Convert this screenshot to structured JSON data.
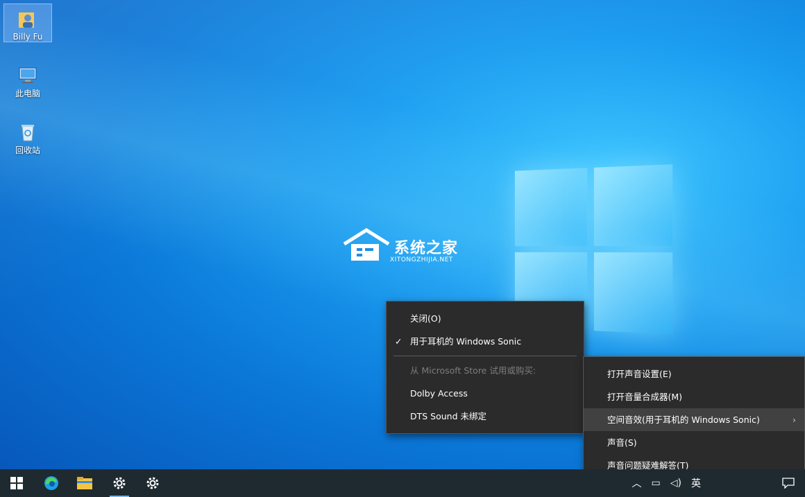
{
  "desktop": {
    "icons": [
      {
        "label": "Billy Fu",
        "icon": "user-folder-icon"
      },
      {
        "label": "此电脑",
        "icon": "computer-icon"
      },
      {
        "label": "回收站",
        "icon": "recycle-bin-icon"
      }
    ],
    "watermark": {
      "title": "系统之家",
      "subtitle": "XITONGZHIJIA.NET"
    }
  },
  "submenu": {
    "items": [
      {
        "label": "关闭(O)",
        "checked": false,
        "disabled": false
      },
      {
        "label": "用于耳机的 Windows Sonic",
        "checked": true,
        "disabled": false
      },
      {
        "label": "从 Microsoft Store 试用或购买:",
        "disabled": true
      },
      {
        "label": "Dolby Access",
        "disabled": false
      },
      {
        "label": "DTS Sound 未绑定",
        "disabled": false
      }
    ],
    "check_glyph": "✓"
  },
  "context_menu": {
    "items": [
      {
        "label": "打开声音设置(E)"
      },
      {
        "label": "打开音量合成器(M)"
      },
      {
        "label": "空间音效(用于耳机的 Windows Sonic)",
        "has_submenu": true,
        "highlighted": true
      },
      {
        "label": "声音(S)"
      },
      {
        "label": "声音问题疑难解答(T)"
      }
    ],
    "arrow_glyph": "›"
  },
  "taskbar": {
    "buttons": [
      {
        "icon": "windows-start-icon"
      },
      {
        "icon": "edge-browser-icon"
      },
      {
        "icon": "file-explorer-icon"
      },
      {
        "icon": "settings-icon",
        "active": true
      },
      {
        "icon": "settings-icon"
      }
    ],
    "tray": {
      "ime": "英"
    }
  },
  "colors": {
    "menu_bg": "#2b2b2b",
    "menu_hover": "#414141",
    "taskbar_bg": "#1f2a30"
  }
}
